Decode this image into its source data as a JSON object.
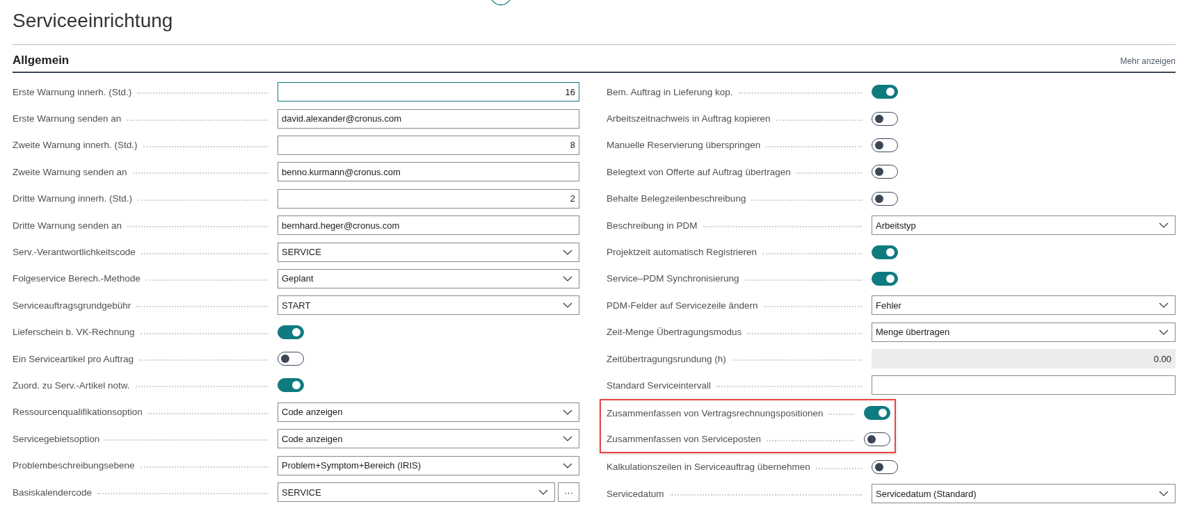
{
  "page": {
    "title": "Serviceeinrichtung"
  },
  "section": {
    "title": "Allgemein",
    "more_link": "Mehr anzeigen"
  },
  "left_column": [
    {
      "kind": "number",
      "label": "Erste Warnung innerh. (Std.)",
      "value": "16",
      "focused": true
    },
    {
      "kind": "text",
      "label": "Erste Warnung senden an",
      "value": "david.alexander@cronus.com",
      "focused": false
    },
    {
      "kind": "number",
      "label": "Zweite Warnung innerh. (Std.)",
      "value": "8",
      "focused": false
    },
    {
      "kind": "text",
      "label": "Zweite Warnung senden an",
      "value": "benno.kurmann@cronus.com",
      "focused": false
    },
    {
      "kind": "number",
      "label": "Dritte Warnung innerh. (Std.)",
      "value": "2",
      "focused": false
    },
    {
      "kind": "text",
      "label": "Dritte Warnung senden an",
      "value": "bernhard.heger@cronus.com",
      "focused": false
    },
    {
      "kind": "select",
      "label": "Serv.-Verantwortlichkeitscode",
      "value": "SERVICE"
    },
    {
      "kind": "select",
      "label": "Folgeservice Berech.-Methode",
      "value": "Geplant"
    },
    {
      "kind": "select",
      "label": "Serviceauftragsgrundgebühr",
      "value": "START"
    },
    {
      "kind": "toggle",
      "label": "Lieferschein b. VK-Rechnung",
      "on": true
    },
    {
      "kind": "toggle",
      "label": "Ein Serviceartikel pro Auftrag",
      "on": false
    },
    {
      "kind": "toggle",
      "label": "Zuord. zu Serv.-Artikel notw.",
      "on": true
    },
    {
      "kind": "select",
      "label": "Ressourcenqualifikationsoption",
      "value": "Code anzeigen"
    },
    {
      "kind": "select",
      "label": "Servicegebietsoption",
      "value": "Code anzeigen"
    },
    {
      "kind": "select",
      "label": "Problembeschreibungsebene",
      "value": "Problem+Symptom+Bereich (IRIS)"
    },
    {
      "kind": "lookup",
      "label": "Basiskalendercode",
      "value": "SERVICE",
      "button": "···"
    }
  ],
  "right_column": [
    {
      "kind": "toggle",
      "label": "Bem. Auftrag in Lieferung kop.",
      "on": true,
      "highlighted": false
    },
    {
      "kind": "toggle",
      "label": "Arbeitszeitnachweis in Auftrag kopieren",
      "on": false,
      "highlighted": false
    },
    {
      "kind": "toggle",
      "label": "Manuelle Reservierung überspringen",
      "on": false,
      "highlighted": false
    },
    {
      "kind": "toggle",
      "label": "Belegtext von Offerte auf Auftrag übertragen",
      "on": false,
      "highlighted": false
    },
    {
      "kind": "toggle",
      "label": "Behalte Belegzeilenbeschreibung",
      "on": false,
      "highlighted": false
    },
    {
      "kind": "select",
      "label": "Beschreibung in PDM",
      "value": "Arbeitstyp",
      "highlighted": false
    },
    {
      "kind": "toggle",
      "label": "Projektzeit automatisch Registrieren",
      "on": true,
      "highlighted": false
    },
    {
      "kind": "toggle",
      "label": "Service–PDM Synchronisierung",
      "on": true,
      "highlighted": false
    },
    {
      "kind": "select",
      "label": "PDM-Felder auf Servicezeile ändern",
      "value": "Fehler",
      "highlighted": false
    },
    {
      "kind": "select",
      "label": "Zeit-Menge Übertragungsmodus",
      "value": "Menge übertragen",
      "highlighted": false
    },
    {
      "kind": "readonly",
      "label": "Zeitübertragungsrundung (h)",
      "value": "0.00",
      "highlighted": false
    },
    {
      "kind": "text",
      "label": "Standard Serviceintervall",
      "focused": false,
      "highlighted": false
    },
    {
      "kind": "toggle",
      "label": "Zusammenfassen von Vertragsrechnungspositionen",
      "on": true,
      "highlighted": true
    },
    {
      "kind": "toggle",
      "label": "Zusammenfassen von Serviceposten",
      "on": false,
      "highlighted": true
    },
    {
      "kind": "toggle",
      "label": "Kalkulationszeilen in Serviceauftrag übernehmen",
      "on": false,
      "highlighted": false
    },
    {
      "kind": "select",
      "label": "Servicedatum",
      "value": "Servicedatum (Standard)",
      "highlighted": false
    }
  ]
}
